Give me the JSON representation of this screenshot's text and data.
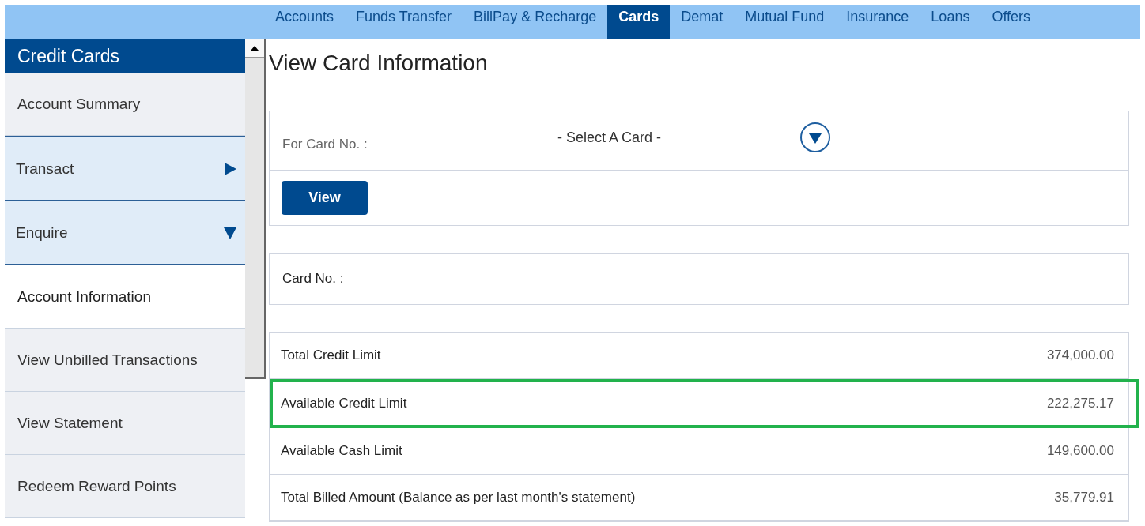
{
  "nav": [
    {
      "label": "Accounts",
      "selected": false
    },
    {
      "label": "Funds Transfer",
      "selected": false
    },
    {
      "label": "BillPay & Recharge",
      "selected": false
    },
    {
      "label": "Cards",
      "selected": true
    },
    {
      "label": "Demat",
      "selected": false
    },
    {
      "label": "Mutual Fund",
      "selected": false
    },
    {
      "label": "Insurance",
      "selected": false
    },
    {
      "label": "Loans",
      "selected": false
    },
    {
      "label": "Offers",
      "selected": false
    }
  ],
  "sidebar": {
    "title": "Credit Cards",
    "items": [
      {
        "kind": "link",
        "label": "Account Summary",
        "selected": false
      },
      {
        "kind": "section",
        "label": "Transact",
        "expanded": false
      },
      {
        "kind": "section",
        "label": "Enquire",
        "expanded": true
      },
      {
        "kind": "link",
        "label": "Account Information",
        "selected": true
      },
      {
        "kind": "link",
        "label": "View Unbilled Transactions",
        "selected": false
      },
      {
        "kind": "link",
        "label": "View Statement",
        "selected": false
      },
      {
        "kind": "link",
        "label": "Redeem Reward Points",
        "selected": false
      }
    ]
  },
  "page_title": "View Card Information",
  "card_select": {
    "label": "For Card No. :",
    "value": "- Select A Card -",
    "button": "View"
  },
  "card_no": {
    "label": "Card No. :"
  },
  "limits": [
    {
      "label": "Total Credit Limit",
      "amount": "374,000.00",
      "highlighted": false
    },
    {
      "label": "Available Credit Limit",
      "amount": "222,275.17",
      "highlighted": true
    },
    {
      "label": "Available Cash Limit",
      "amount": "149,600.00",
      "highlighted": false
    },
    {
      "label": "Total Billed Amount (Balance as per last month's statement)",
      "amount": "35,779.91",
      "highlighted": false
    }
  ]
}
